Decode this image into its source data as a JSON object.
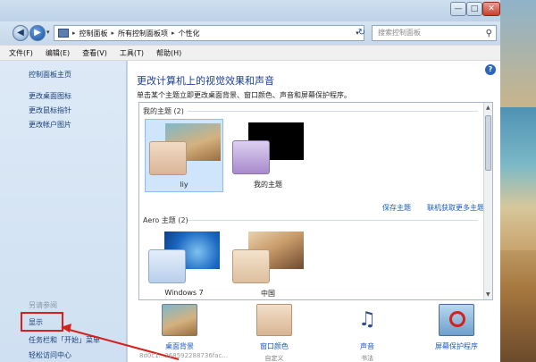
{
  "window": {
    "minimize": "—",
    "maximize": "□",
    "close": "✕"
  },
  "address": {
    "back": "◀",
    "forward": "▶",
    "crumbs": [
      "控制面板",
      "所有控制面板项",
      "个性化"
    ],
    "search_placeholder": "搜索控制面板"
  },
  "menu": [
    "文件(F)",
    "编辑(E)",
    "查看(V)",
    "工具(T)",
    "帮助(H)"
  ],
  "sidebar": {
    "home": "控制面板主页",
    "links": [
      "更改桌面图标",
      "更改鼠标指针",
      "更改帐户图片"
    ],
    "see_also": "另请参阅",
    "display": "显示",
    "taskbar": "任务栏和「开始」菜单",
    "ease": "轻松访问中心"
  },
  "content": {
    "heading": "更改计算机上的视觉效果和声音",
    "subtitle": "单击某个主题立即更改桌面背景、窗口颜色、声音和屏幕保护程序。",
    "my_themes_label": "我的主题 (2)",
    "save_theme": "保存主题",
    "get_more": "联机获取更多主题",
    "aero_label": "Aero 主题 (2)",
    "my_themes": [
      {
        "name": "liy",
        "selected": true
      },
      {
        "name": "我的主题",
        "selected": false
      }
    ],
    "aero_themes": [
      {
        "name": "Windows 7"
      },
      {
        "name": "中国"
      }
    ]
  },
  "bottom": [
    {
      "label": "桌面背景",
      "sub": ""
    },
    {
      "label": "窗口颜色",
      "sub": "自定义"
    },
    {
      "label": "声音",
      "sub": "书法"
    },
    {
      "label": "屏幕保护程序",
      "sub": ""
    }
  ],
  "watermark": "8d0c1...268592288736fac..."
}
